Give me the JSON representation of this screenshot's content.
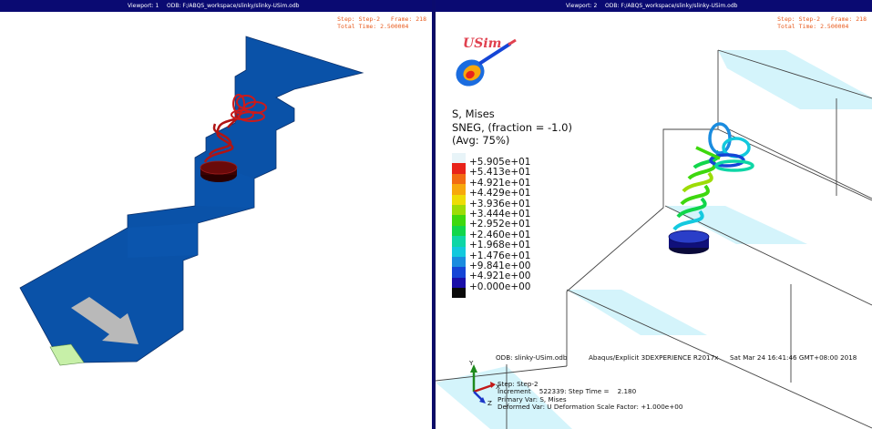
{
  "viewport1": {
    "label": "Viewport: 1",
    "odb": "ODB: F:/ABQS_workspace/slinky/slinky-USim.odb",
    "step": "Step: Step-2",
    "frame": "Frame: 218",
    "total_time": "Total Time: 2.500004"
  },
  "viewport2": {
    "label": "Viewport: 2",
    "odb": "ODB: F:/ABQS_workspace/slinky/slinky-USim.odb",
    "step": "Step: Step-2",
    "frame": "Frame: 218",
    "total_time": "Total Time: 2.500004",
    "logo": "USim",
    "legend": {
      "title_line1": "S, Mises",
      "title_line2": "SNEG, (fraction = -1.0)",
      "title_line3": "(Avg: 75%)",
      "values": [
        "+5.905e+01",
        "+5.413e+01",
        "+4.921e+01",
        "+4.429e+01",
        "+3.936e+01",
        "+3.444e+01",
        "+2.952e+01",
        "+2.460e+01",
        "+1.968e+01",
        "+1.476e+01",
        "+9.841e+00",
        "+4.921e+00",
        "+0.000e+00"
      ],
      "colors": [
        "#e8f4f8",
        "#e8231a",
        "#f26b12",
        "#f7a80c",
        "#eedc05",
        "#9ddc06",
        "#3ed80e",
        "#11d64b",
        "#0ed6a6",
        "#12c9dd",
        "#1a8cdf",
        "#1545d6",
        "#1a0fa8",
        "#0a0a0a"
      ]
    },
    "info": {
      "odb_line": "ODB: slinky-USim.odb",
      "solver": "Abaqus/Explicit 3DEXPERIENCE R2017x",
      "date": "Sat Mar 24 16:41:46 GMT+08:00 2018",
      "step": "Step: Step-2",
      "increment": "Increment    522339: Step Time =    2.180",
      "primary": "Primary Var: S, Mises",
      "deformed": "Deformed Var: U   Deformation Scale Factor: +1.000e+00"
    },
    "triad": {
      "x": "X",
      "y": "Y",
      "z": "Z"
    }
  }
}
